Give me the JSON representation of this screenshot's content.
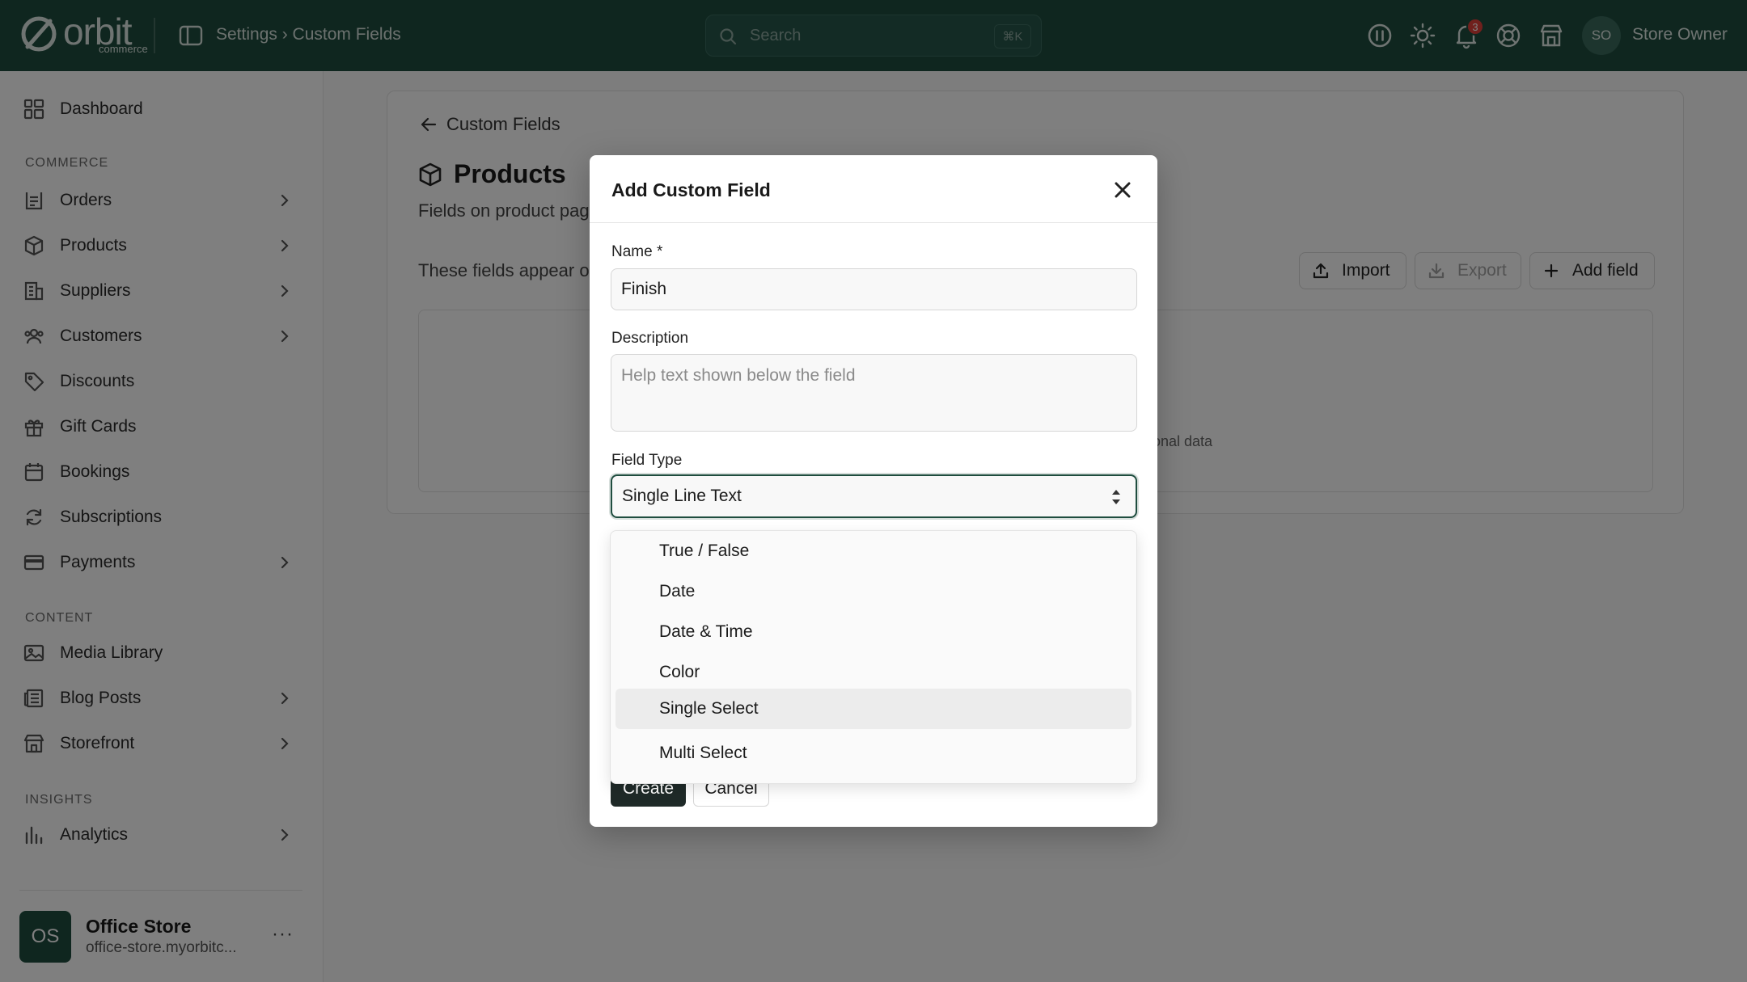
{
  "topbar": {
    "logo_word": "orbit",
    "logo_sub": "commerce",
    "breadcrumb": "Settings › Custom Fields",
    "search_placeholder": "Search",
    "search_shortcut": "⌘K",
    "notification_count": "3",
    "user_initials": "SO",
    "user_name": "Store Owner"
  },
  "sidebar": {
    "dashboard": "Dashboard",
    "sections": {
      "commerce": "COMMERCE",
      "content": "CONTENT",
      "insights": "INSIGHTS"
    },
    "items": [
      {
        "label": "Orders"
      },
      {
        "label": "Products"
      },
      {
        "label": "Suppliers"
      },
      {
        "label": "Customers"
      },
      {
        "label": "Discounts"
      },
      {
        "label": "Gift Cards"
      },
      {
        "label": "Bookings"
      },
      {
        "label": "Subscriptions"
      },
      {
        "label": "Payments"
      },
      {
        "label": "Media Library"
      },
      {
        "label": "Blog Posts"
      },
      {
        "label": "Storefront"
      },
      {
        "label": "Analytics"
      }
    ],
    "store": {
      "initials": "OS",
      "name": "Office Store",
      "url": "office-store.myorbitc...",
      "more": "···"
    }
  },
  "page": {
    "back_label": "Custom Fields",
    "title": "Products",
    "subtitle": "Fields on product pag",
    "note": "These fields appear o",
    "import_label": "Import",
    "export_label": "Export",
    "add_label": "Add field",
    "empty_text": "onal data"
  },
  "modal": {
    "title": "Add Custom Field",
    "name_label": "Name *",
    "name_value": "Finish",
    "description_label": "Description",
    "description_placeholder": "Help text shown below the field",
    "type_label": "Field Type",
    "type_value": "Single Line Text",
    "create_label": "Create",
    "cancel_label": "Cancel"
  },
  "dropdown": {
    "options": [
      {
        "label": "True / False"
      },
      {
        "label": "Date"
      },
      {
        "label": "Date & Time"
      },
      {
        "label": "Color"
      },
      {
        "label": "Single Select"
      },
      {
        "label": "Multi Select"
      }
    ],
    "highlighted": "Single Select"
  },
  "colors": {
    "brand": "#1f4d3f",
    "badge": "#e0403a"
  }
}
